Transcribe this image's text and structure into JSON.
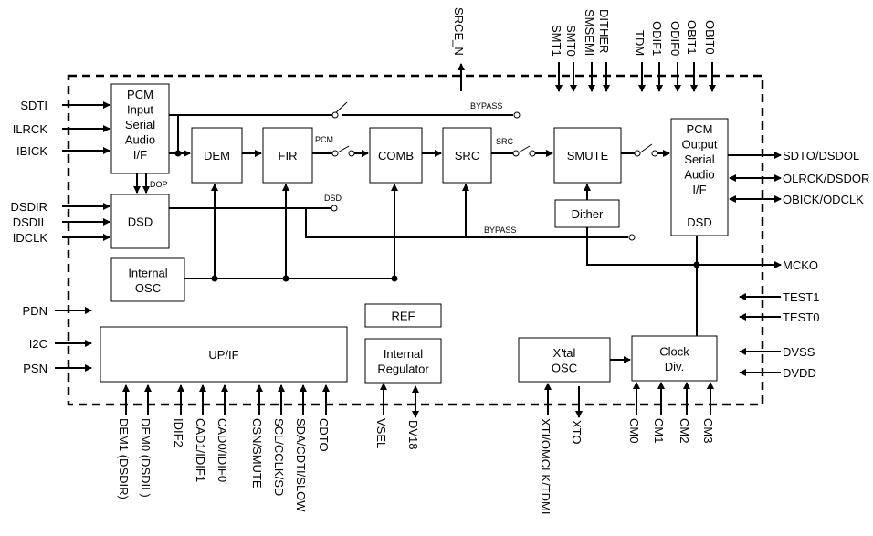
{
  "blocks": {
    "pcm_in": [
      "PCM",
      "Input",
      "Serial",
      "Audio",
      "I/F"
    ],
    "dsd_in": "DSD",
    "dem": "DEM",
    "fir": "FIR",
    "comb": "COMB",
    "src": "SRC",
    "smute": "SMUTE",
    "dither": "Dither",
    "pcm_out": [
      "PCM",
      "Output",
      "Serial",
      "Audio",
      "I/F"
    ],
    "pcm_out_dsd": "DSD",
    "osc": [
      "Internal",
      "OSC"
    ],
    "ref": "REF",
    "regulator": [
      "Internal",
      "Regulator"
    ],
    "upif": "UP/IF",
    "xtal": [
      "X'tal",
      "OSC"
    ],
    "clock": [
      "Clock",
      "Div."
    ]
  },
  "labels": {
    "bypass1": "BYPASS",
    "bypass2": "BYPASS",
    "pcm": "PCM",
    "src": "SRC",
    "dsd": "DSD",
    "dop": "DOP"
  },
  "pins_left": [
    "SDTI",
    "ILRCK",
    "IBICK",
    "DSDIR",
    "DSDIL",
    "IDCLK",
    "PDN",
    "I2C",
    "PSN"
  ],
  "pins_right": [
    "SDTO/DSDOL",
    "OLRCK/DSDOR",
    "OBICK/ODCLK",
    "MCKO",
    "TEST1",
    "TEST0",
    "DVSS",
    "DVDD"
  ],
  "pins_top": [
    "SRCE_N",
    "SMT1",
    "SMT0",
    "SMSEMI",
    "DITHER",
    "TDM",
    "ODIF1",
    "ODIF0",
    "OBIT1",
    "OBIT0"
  ],
  "pins_bottom": [
    "DEM1 (DSDIR)",
    "DEM0 (DSDIL)",
    "IDIF2",
    "CAD1/IDIF1",
    "CAD0/IDIF0",
    "CSN/SMUTE",
    "SCL/CCLK/SD",
    "SDA/CDTI/SLOW",
    "CDTO",
    "VSEL",
    "DV18",
    "XTI/OMCLK/TDMI",
    "XTO",
    "CM0",
    "CM1",
    "CM2",
    "CM3"
  ]
}
